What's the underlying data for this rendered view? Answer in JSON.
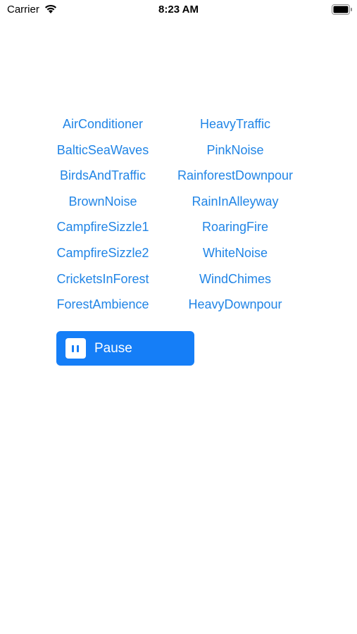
{
  "status_bar": {
    "carrier": "Carrier",
    "time": "8:23 AM",
    "wifi_icon": "wifi-icon",
    "battery_icon": "battery-icon"
  },
  "sounds": {
    "left": [
      "AirConditioner",
      "BalticSeaWaves",
      "BirdsAndTraffic",
      "BrownNoise",
      "CampfireSizzle1",
      "CampfireSizzle2",
      "CricketsInForest",
      "ForestAmbience"
    ],
    "right": [
      "HeavyTraffic",
      "PinkNoise",
      "RainforestDownpour",
      "RainInAlleyway",
      "RoaringFire",
      "WhiteNoise",
      "WindChimes",
      "HeavyDownpour"
    ]
  },
  "playback": {
    "pause_label": "Pause",
    "pause_icon": "pause-icon"
  },
  "colors": {
    "accent": "#157EF7",
    "link": "#2185E6",
    "background": "#FFFFFF"
  }
}
